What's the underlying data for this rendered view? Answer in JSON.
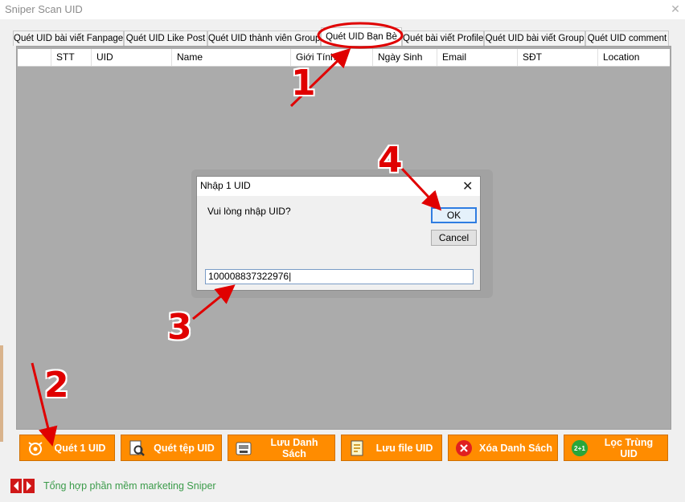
{
  "window": {
    "title": "Sniper Scan UID",
    "close_glyph": "✕"
  },
  "tabs": [
    {
      "label": "Quét UID bài viết Fanpage"
    },
    {
      "label": "Quét UID Like Post"
    },
    {
      "label": "Quét UID thành viên Group"
    },
    {
      "label": "Quét UID Bạn Bè",
      "active": true
    },
    {
      "label": "Quét bài viết Profile"
    },
    {
      "label": "Quét UID bài viết Group"
    },
    {
      "label": "Quét UID comment"
    }
  ],
  "grid": {
    "columns": [
      "",
      "STT",
      "UID",
      "Name",
      "Giới Tính",
      "Ngày Sinh",
      "Email",
      "SĐT",
      "Location"
    ]
  },
  "dialog": {
    "title": "Nhập 1 UID",
    "close_glyph": "✕",
    "prompt": "Vui lòng nhập UID?",
    "ok_label": "OK",
    "cancel_label": "Cancel",
    "input_value": "100008837322976|"
  },
  "toolbar": {
    "buttons": [
      {
        "label": "Quét 1 UID",
        "icon": "scan-one-icon"
      },
      {
        "label": "Quét tệp UID",
        "icon": "scan-file-icon"
      },
      {
        "label": "Lưu Danh Sách",
        "icon": "save-list-icon"
      },
      {
        "label": "Lưu file UID",
        "icon": "save-file-icon"
      },
      {
        "label": "Xóa Danh Sách",
        "icon": "delete-icon"
      },
      {
        "label": "Lọc Trùng UID",
        "icon": "filter-duplicate-icon",
        "icon_text": "2+1"
      }
    ]
  },
  "footer": {
    "link_text": "Tổng hợp phần mềm marketing Sniper"
  },
  "annotations": {
    "n1": "1",
    "n2": "2",
    "n3": "3",
    "n4": "4"
  },
  "colors": {
    "accent_orange": "#ff8c00",
    "annotation_red": "#e00000",
    "footer_green": "#3b9b4a"
  }
}
